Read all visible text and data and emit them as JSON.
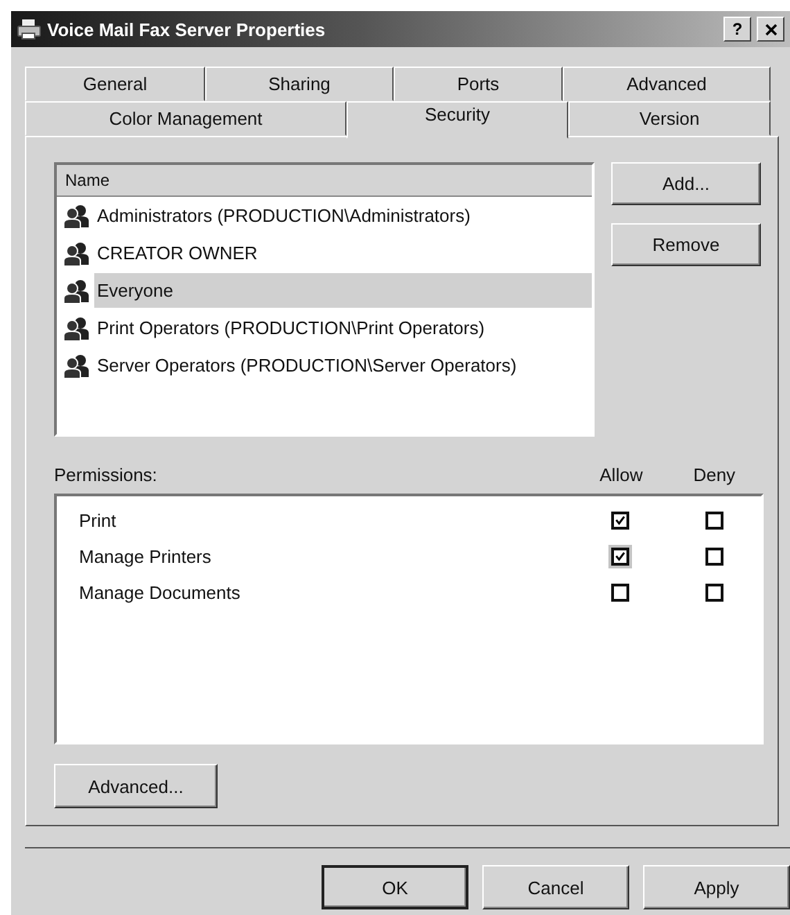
{
  "window": {
    "title": "Voice Mail Fax Server Properties",
    "help_button": "?"
  },
  "tab_rows": [
    {
      "tabs": [
        {
          "label": "General",
          "selected": false
        },
        {
          "label": "Sharing",
          "selected": false
        },
        {
          "label": "Ports",
          "selected": false
        },
        {
          "label": "Advanced",
          "selected": false
        }
      ]
    },
    {
      "tabs": [
        {
          "label": "Color Management",
          "selected": false
        },
        {
          "label": "Security",
          "selected": true
        },
        {
          "label": "Version",
          "selected": false
        }
      ]
    }
  ],
  "names": {
    "column": "Name",
    "items": [
      {
        "label": "Administrators (PRODUCTION\\Administrators)",
        "selected": false
      },
      {
        "label": "CREATOR OWNER",
        "selected": false
      },
      {
        "label": "Everyone",
        "selected": true
      },
      {
        "label": "Print Operators (PRODUCTION\\Print Operators)",
        "selected": false
      },
      {
        "label": "Server Operators (PRODUCTION\\Server Operators)",
        "selected": false
      }
    ]
  },
  "side_buttons": [
    "Add...",
    "Remove"
  ],
  "permissions": {
    "label": "Permissions:",
    "columns": [
      "Allow",
      "Deny"
    ],
    "items": [
      {
        "name": "Print",
        "allow": true,
        "deny": false,
        "focused": false
      },
      {
        "name": "Manage Printers",
        "allow": true,
        "deny": false,
        "focused": true
      },
      {
        "name": "Manage Documents",
        "allow": false,
        "deny": false,
        "focused": false
      }
    ]
  },
  "advanced_button": "Advanced...",
  "buttons": [
    {
      "label": "OK",
      "default": true
    },
    {
      "label": "Cancel",
      "default": false
    },
    {
      "label": "Apply",
      "default": false
    }
  ]
}
